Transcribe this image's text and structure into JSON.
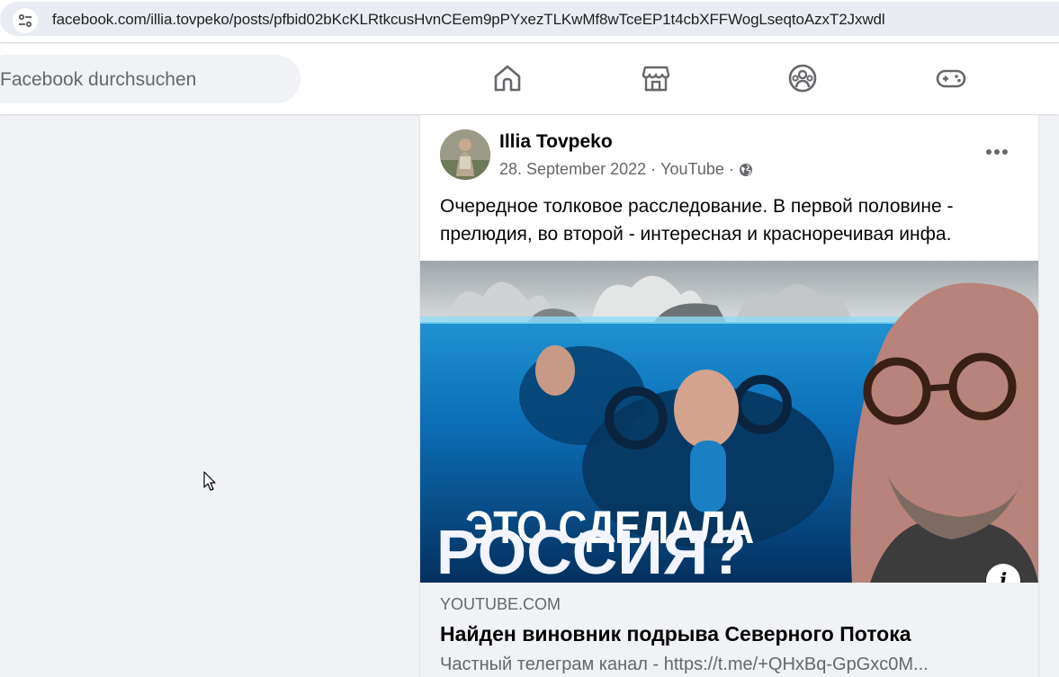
{
  "browser": {
    "url": "facebook.com/illia.tovpeko/posts/pfbid02bKcKLRtkcusHvnCEem9pPYxezTLKwMf8wTceEP1t4cbXFFWogLseqtoAzxT2Jxwdl",
    "site_info_icon": "tune-icon"
  },
  "nav": {
    "search_placeholder": "Facebook durchsuchen",
    "icons": [
      "home-icon",
      "marketplace-icon",
      "groups-icon",
      "gaming-icon"
    ]
  },
  "post": {
    "author": "Illia Tovpeko",
    "date": "28. September 2022",
    "separator": "·",
    "source": "YouTube",
    "privacy_icon": "globe-icon",
    "text": "Очередное толковое расследование. В первой половине - прелюдия, во второй - интересная и красноречивая инфа.",
    "thumbnail": {
      "line1": "ЭТО СДЕЛАЛА",
      "line2": "РОССИЯ?"
    },
    "info_label": "i",
    "link": {
      "domain": "YOUTUBE.COM",
      "title": "Найден виновник подрыва Северного Потока",
      "description": "Частный телеграм канал - https://t.me/+QHxBq-GpGxc0M..."
    }
  },
  "colors": {
    "page_bg": "#f0f2f5",
    "card_bg": "#ffffff",
    "secondary_text": "#65676b",
    "icon_color": "#65676b"
  }
}
